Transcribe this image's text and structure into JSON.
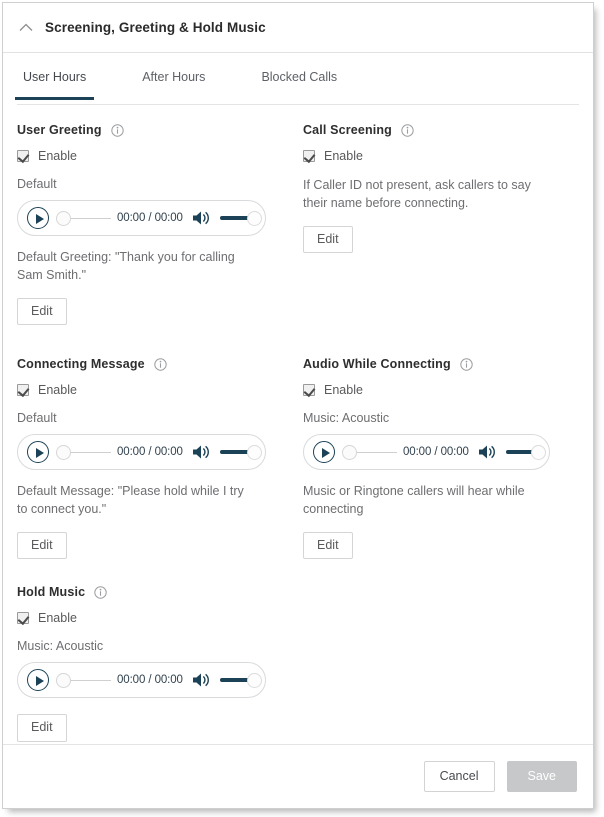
{
  "panel": {
    "title": "Screening, Greeting & Hold Music",
    "collapse_icon": "chevron-up-icon"
  },
  "tabs": [
    {
      "label": "User Hours",
      "active": true
    },
    {
      "label": "After Hours",
      "active": false
    },
    {
      "label": "Blocked Calls",
      "active": false
    }
  ],
  "common": {
    "enable_label": "Enable",
    "edit_label": "Edit",
    "info_icon": "info-icon",
    "play_icon": "play-icon",
    "volume_icon": "volume-icon",
    "time_display": "00:00 / 00:00"
  },
  "sections": {
    "user_greeting": {
      "title": "User Greeting",
      "enable_label": "Enable",
      "enabled": true,
      "source_label": "Default",
      "time_display": "00:00 / 00:00",
      "description": "Default Greeting: \"Thank you for calling Sam Smith.\"",
      "edit_label": "Edit"
    },
    "call_screening": {
      "title": "Call Screening",
      "enable_label": "Enable",
      "enabled": true,
      "description": "If Caller ID not present, ask callers to say their name before connecting.",
      "edit_label": "Edit"
    },
    "connecting_message": {
      "title": "Connecting Message",
      "enable_label": "Enable",
      "enabled": true,
      "source_label": "Default",
      "time_display": "00:00 / 00:00",
      "description": "Default Message: \"Please hold while I try to connect you.\"",
      "edit_label": "Edit"
    },
    "audio_while_connecting": {
      "title": "Audio While Connecting",
      "enable_label": "Enable",
      "enabled": true,
      "source_label": "Music: Acoustic",
      "time_display": "00:00 / 00:00",
      "description": "Music or Ringtone callers will hear while connecting",
      "edit_label": "Edit"
    },
    "hold_music": {
      "title": "Hold Music",
      "enable_label": "Enable",
      "enabled": true,
      "source_label": "Music: Acoustic",
      "time_display": "00:00 / 00:00",
      "edit_label": "Edit"
    }
  },
  "footer": {
    "cancel_label": "Cancel",
    "save_label": "Save",
    "save_disabled": true
  },
  "colors": {
    "accent": "#1c4257",
    "text_dark": "#2e2e2e",
    "text_muted": "#6d6e71",
    "border": "#d8dadc",
    "disabled_bg": "#c6c8ca"
  }
}
